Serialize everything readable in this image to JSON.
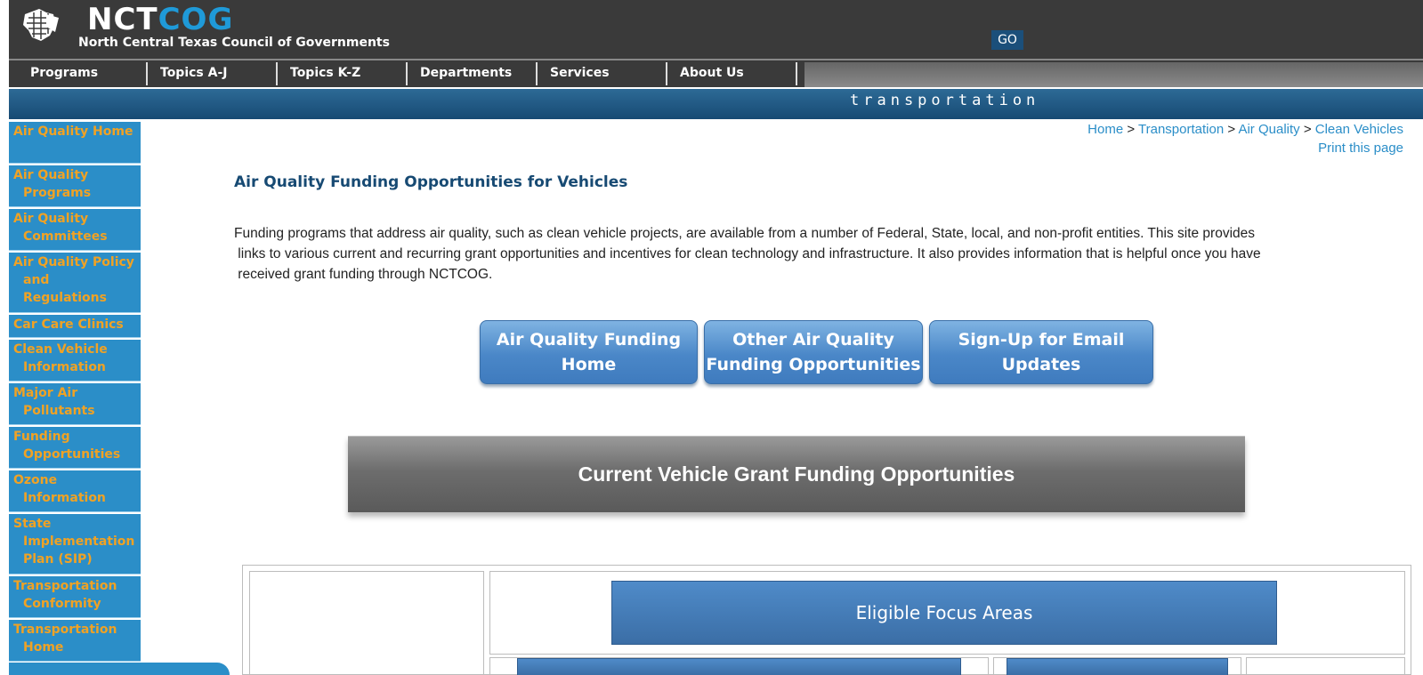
{
  "header": {
    "logo_brand_white": "NCT",
    "logo_brand_blue": "COG",
    "logo_subtitle": "North Central Texas Council of Governments",
    "go_label": "GO",
    "section_label": "transportation"
  },
  "nav": {
    "items": [
      "Programs",
      "Topics A-J",
      "Topics K-Z",
      "Departments",
      "Services",
      "About Us"
    ]
  },
  "sidebar": {
    "items": [
      "Air Quality Home",
      "Air Quality Programs",
      "Air Quality Committees",
      "Air Quality Policy and Regulations",
      "Car Care Clinics",
      "Clean Vehicle Information",
      "Major Air Pollutants",
      "Funding Opportunities",
      "Ozone Information",
      "State Implementation Plan (SIP)",
      "Transportation Conformity",
      "Transportation Home"
    ]
  },
  "breadcrumb": {
    "home": "Home",
    "sep": ">",
    "transportation": "Transportation",
    "air_quality": "Air Quality",
    "clean_vehicles": "Clean Vehicles",
    "print": "Print this page"
  },
  "main": {
    "title": "Air Quality Funding Opportunities for Vehicles",
    "intro_line1": "Funding programs that address air quality, such as clean vehicle projects, are available from a number of Federal, State, local, and non-profit entities.  This site provides",
    "intro_line2": " links to various current and recurring grant opportunities and incentives for clean technology and infrastructure. It also provides information that is helpful once you have",
    "intro_line3": " received grant funding through NCTCOG.",
    "buttons": {
      "aq_home_l1": "Air Quality Funding",
      "aq_home_l2": "Home",
      "other_l1": "Other Air Quality",
      "other_l2": "Funding Opportunities",
      "signup_l1": "Sign-Up for Email",
      "signup_l2": "Updates"
    },
    "banner": "Current Vehicle Grant Funding Opportunities",
    "focus_areas": "Eligible Focus Areas"
  },
  "colors": {
    "header_bg": "#3a3a3a",
    "accent_blue": "#2b8ec8",
    "sidebar_text": "#f0a224",
    "band_blue": "#174a73"
  }
}
